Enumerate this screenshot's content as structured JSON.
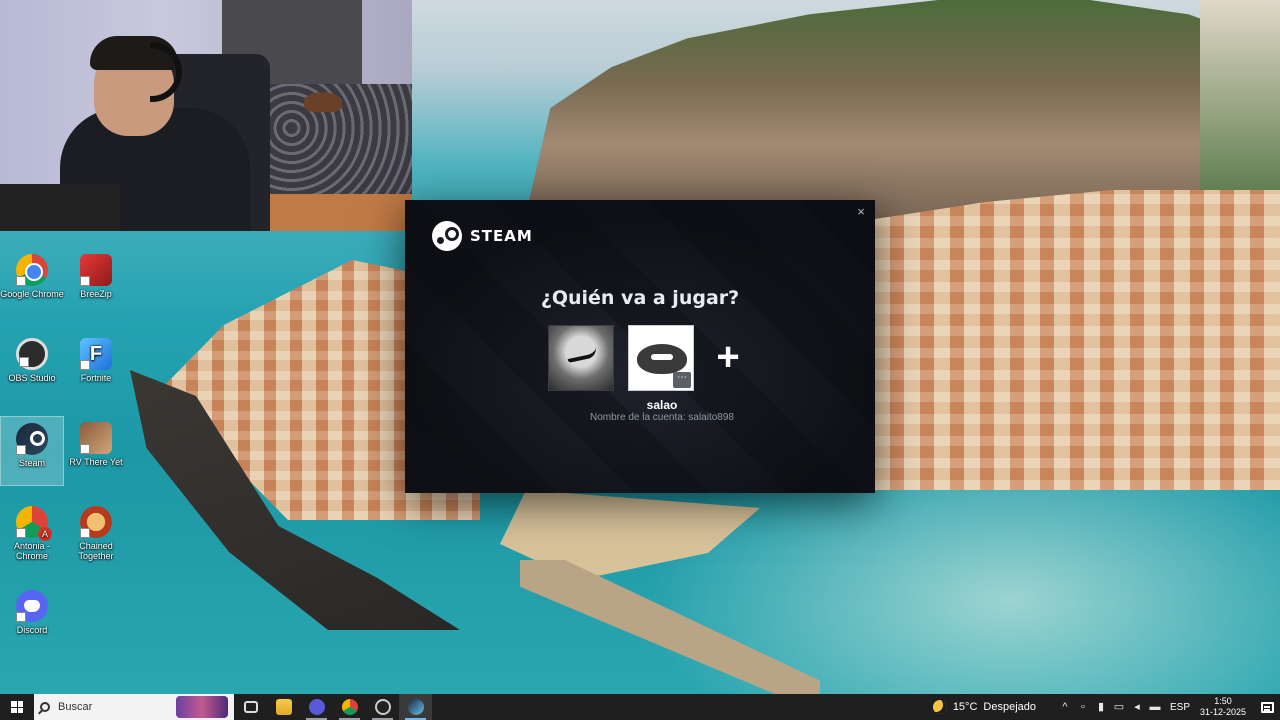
{
  "desktop": {
    "icons": [
      {
        "label": "Google Chrome",
        "icon": "chrome-icon"
      },
      {
        "label": "BreeZip",
        "icon": "breezip-icon"
      },
      {
        "label": "OBS Studio",
        "icon": "obs-icon"
      },
      {
        "label": "Fortnite",
        "icon": "fortnite-icon"
      },
      {
        "label": "Steam",
        "icon": "steam-icon"
      },
      {
        "label": "RV There Yet",
        "icon": "rv-there-yet-icon"
      },
      {
        "label": "Antonia - Chrome",
        "icon": "chrome-profile-icon"
      },
      {
        "label": "Chained Together",
        "icon": "chained-together-icon"
      },
      {
        "label": "Discord",
        "icon": "discord-icon"
      }
    ]
  },
  "steam_dialog": {
    "logo_text": "STEAM",
    "close_glyph": "×",
    "heading": "¿Quién va a jugar?",
    "accounts": [
      {
        "avatar": "nike-avatar"
      },
      {
        "avatar": "blob-avatar",
        "menu_glyph": "⋯"
      }
    ],
    "add_glyph": "+",
    "selected_account_name": "salao",
    "selected_account_sub": "Nombre de la cuenta: salaito898"
  },
  "taskbar": {
    "search_placeholder": "Buscar",
    "weather_temp": "15°C",
    "weather_text": "Despejado",
    "tray_chevron": "^",
    "language": "ESP",
    "time": "1:50",
    "date": "31-12-2025"
  },
  "colors": {
    "steam_dialog_bg": "#171a21",
    "taskbar_bg": "#1f1f1f",
    "accent": "#76b9ed"
  }
}
